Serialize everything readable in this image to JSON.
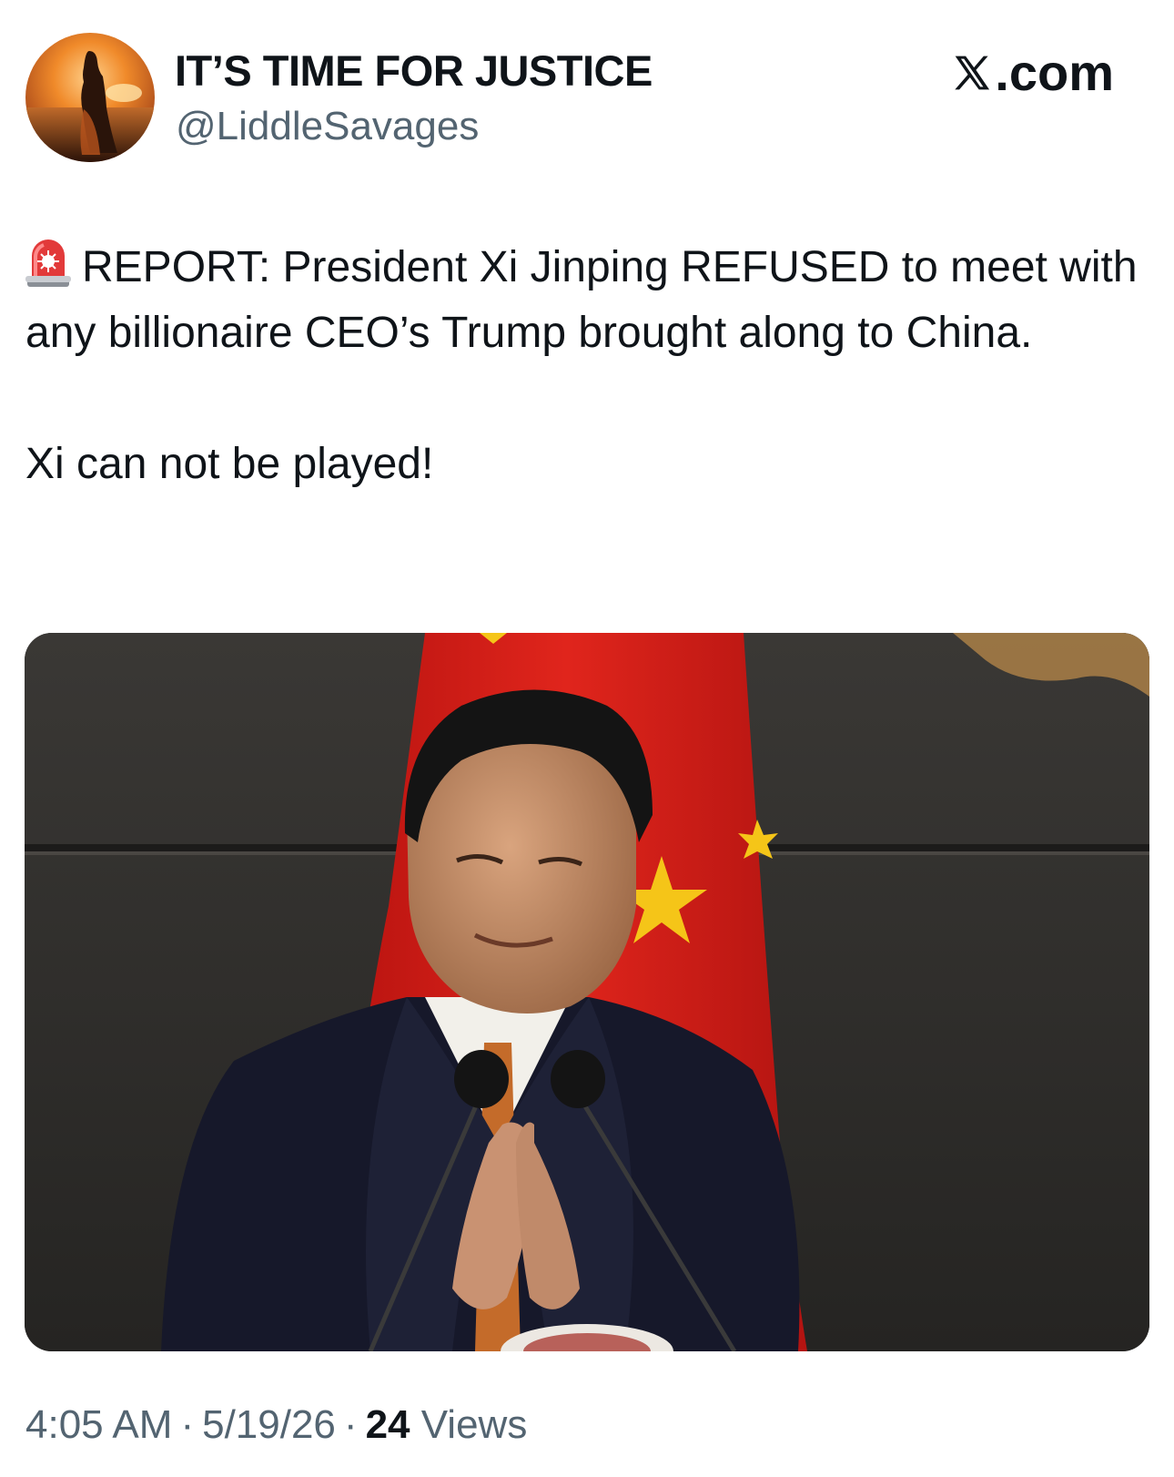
{
  "author": {
    "display_name": "IT’S TIME FOR JUSTICE",
    "handle": "@LiddleSavages"
  },
  "site": {
    "label": ".com",
    "logo_icon": "x-logo-icon"
  },
  "post": {
    "emoji_icon": "rotating-light-icon",
    "line1": "REPORT: President Xi Jinping REFUSED to meet with any billionaire CEO’s Trump brought along to China.",
    "line2": "Xi can not be played!"
  },
  "media": {
    "description_icon": "photo"
  },
  "meta": {
    "time": "4:05 AM",
    "date": "5/19/26",
    "views_count": "24",
    "views_label": "Views",
    "separator": "·"
  },
  "colors": {
    "text": "#0f1419",
    "secondary_text": "#536471",
    "background": "#ffffff",
    "flag_red": "#d81e1b",
    "flag_star": "#f5c518"
  }
}
